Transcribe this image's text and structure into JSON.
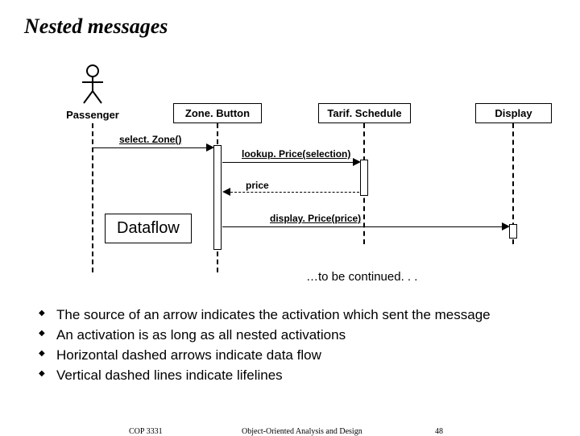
{
  "title": "Nested messages",
  "actor": {
    "label": "Passenger"
  },
  "objects": {
    "zoneButton": "Zone. Button",
    "tarifSchedule": "Tarif. Schedule",
    "display": "Display"
  },
  "messages": {
    "selectZone": "select. Zone()",
    "lookupPrice": "lookup. Price(selection)",
    "price": "price",
    "displayPrice": "display. Price(price)"
  },
  "dataflowLabel": "Dataflow",
  "continued": "…to be continued. . .",
  "bullets": [
    "The source of an arrow indicates the activation which sent the message",
    "An activation is as long as all nested activations",
    "Horizontal dashed arrows indicate data flow",
    "Vertical dashed lines indicate lifelines"
  ],
  "footer": {
    "left": "COP 3331",
    "center": "Object-Oriented Analysis and Design",
    "right": "48"
  }
}
